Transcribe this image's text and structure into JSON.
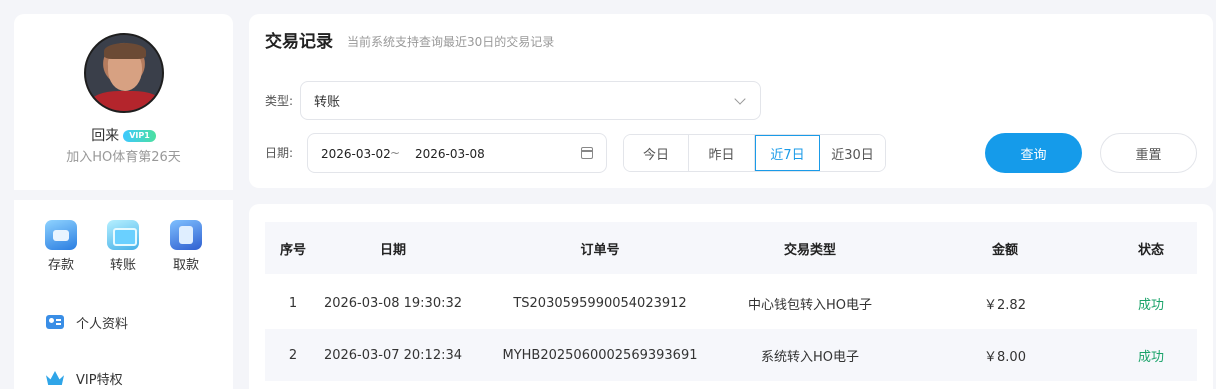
{
  "user": {
    "name": "回来",
    "vip_badge": "VIP1",
    "join_text": "加入HO体育第26天"
  },
  "quick_actions": [
    {
      "label": "存款",
      "icon": "deposit-icon"
    },
    {
      "label": "转账",
      "icon": "transfer-icon"
    },
    {
      "label": "取款",
      "icon": "withdraw-icon"
    }
  ],
  "menu": [
    {
      "label": "个人资料",
      "icon": "profile-card-icon"
    },
    {
      "label": "VIP特权",
      "icon": "crown-icon"
    }
  ],
  "filter": {
    "title": "交易记录",
    "subtitle": "当前系统支持查询最近30日的交易记录",
    "type_label": "类型:",
    "type_value": "转账",
    "date_label": "日期:",
    "date_start": "2026-03-02",
    "date_separator": "~",
    "date_end": "2026-03-08",
    "quick_dates": [
      "今日",
      "昨日",
      "近7日",
      "近30日"
    ],
    "active_quick_date": "近7日",
    "query_label": "查询",
    "reset_label": "重置"
  },
  "table": {
    "headers": [
      "序号",
      "日期",
      "订单号",
      "交易类型",
      "金额",
      "状态"
    ],
    "rows": [
      [
        "1",
        "2026-03-08 19:30:32",
        "TS2030595990054023912",
        "中心钱包转入HO电子",
        "￥2.82",
        "成功"
      ],
      [
        "2",
        "2026-03-07 20:12:34",
        "MYHB2025060002569393691",
        "系统转入HO电子",
        "￥8.00",
        "成功"
      ]
    ]
  },
  "colors": {
    "accent": "#159bea",
    "success": "#1aa36a",
    "background": "#f4f5f9"
  }
}
